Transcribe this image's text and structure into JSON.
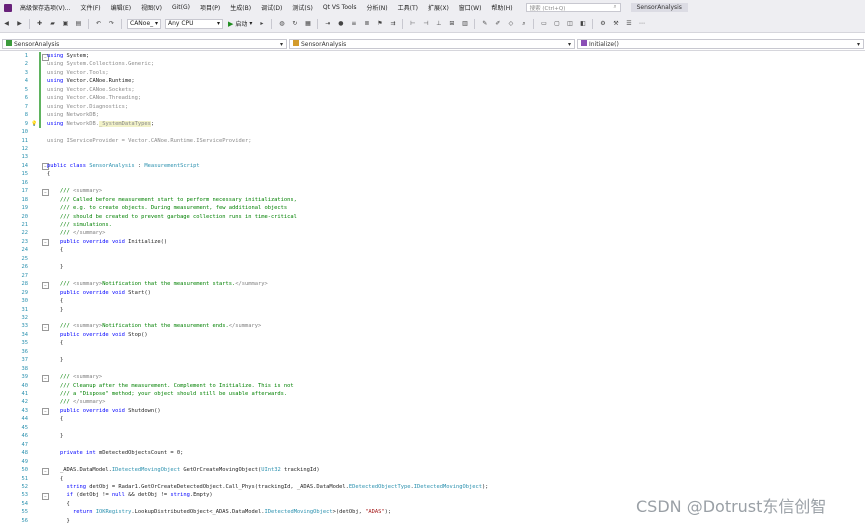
{
  "menu": {
    "title_short": "高级保存选项(V)...",
    "items": [
      "文件(F)",
      "编辑(E)",
      "视图(V)",
      "Git(G)",
      "项目(P)",
      "生成(B)",
      "调试(D)",
      "测试(S)",
      "Qt VS Tools",
      "分析(N)",
      "工具(T)",
      "扩展(X)",
      "窗口(W)",
      "帮助(H)"
    ],
    "search_placeholder": "搜索 (Ctrl+Q)",
    "solution_name": "SensorAnalysis"
  },
  "toolbar": {
    "config": "CANoe_",
    "platform": "Any CPU",
    "start_label": "启动"
  },
  "navbar": {
    "project": "SensorAnalysis",
    "class": "SensorAnalysis",
    "member": "Initialize()"
  },
  "code_lines": [
    {
      "n": "1",
      "t": "using System;"
    },
    {
      "n": "2",
      "t": "using System.Collections.Generic;"
    },
    {
      "n": "3",
      "t": "using Vector.Tools;"
    },
    {
      "n": "4",
      "t": "using Vector.CANoe.Runtime;"
    },
    {
      "n": "5",
      "t": "using Vector.CANoe.Sockets;"
    },
    {
      "n": "6",
      "t": "using Vector.CANoe.Threading;"
    },
    {
      "n": "7",
      "t": "using Vector.Diagnostics;"
    },
    {
      "n": "8",
      "t": "using NetworkDB;"
    },
    {
      "n": "9",
      "t": "using NetworkDB._SystemDataTypes;"
    },
    {
      "n": "10",
      "t": ""
    },
    {
      "n": "11",
      "t": "using IServiceProvider = Vector.CANoe.Runtime.IServiceProvider;"
    },
    {
      "n": "12",
      "t": ""
    },
    {
      "n": "13",
      "t": ""
    },
    {
      "n": "14",
      "t": "public class SensorAnalysis : MeasurementScript"
    },
    {
      "n": "15",
      "t": "{"
    },
    {
      "n": "16",
      "t": ""
    },
    {
      "n": "17",
      "t": "    /// <summary>"
    },
    {
      "n": "18",
      "t": "    /// Called before measurement start to perform necessary initializations,"
    },
    {
      "n": "19",
      "t": "    /// e.g. to create objects. During measurement, few additional objects"
    },
    {
      "n": "20",
      "t": "    /// should be created to prevent garbage collection runs in time-critical"
    },
    {
      "n": "21",
      "t": "    /// simulations."
    },
    {
      "n": "22",
      "t": "    /// </summary>"
    },
    {
      "n": "23",
      "t": "    public override void Initialize()"
    },
    {
      "n": "24",
      "t": "    {"
    },
    {
      "n": "25",
      "t": ""
    },
    {
      "n": "26",
      "t": "    }"
    },
    {
      "n": "27",
      "t": ""
    },
    {
      "n": "28",
      "t": "    /// <summary>Notification that the measurement starts.</summary>"
    },
    {
      "n": "29",
      "t": "    public override void Start()"
    },
    {
      "n": "30",
      "t": "    {"
    },
    {
      "n": "31",
      "t": "    }"
    },
    {
      "n": "32",
      "t": ""
    },
    {
      "n": "33",
      "t": "    /// <summary>Notification that the measurement ends.</summary>"
    },
    {
      "n": "34",
      "t": "    public override void Stop()"
    },
    {
      "n": "35",
      "t": "    {"
    },
    {
      "n": "36",
      "t": ""
    },
    {
      "n": "37",
      "t": "    }"
    },
    {
      "n": "38",
      "t": ""
    },
    {
      "n": "39",
      "t": "    /// <summary>"
    },
    {
      "n": "40",
      "t": "    /// Cleanup after the measurement. Complement to Initialize. This is not"
    },
    {
      "n": "41",
      "t": "    /// a \"Dispose\" method; your object should still be usable afterwards."
    },
    {
      "n": "42",
      "t": "    /// </summary>"
    },
    {
      "n": "43",
      "t": "    public override void Shutdown()"
    },
    {
      "n": "44",
      "t": "    {"
    },
    {
      "n": "45",
      "t": ""
    },
    {
      "n": "46",
      "t": "    }"
    },
    {
      "n": "47",
      "t": ""
    },
    {
      "n": "48",
      "t": "    private int mDetectedObjectsCount = 0;"
    },
    {
      "n": "49",
      "t": ""
    },
    {
      "n": "50",
      "t": "    _ADAS.DataModel.IDetectedMovingObject GetOrCreateMovingObject(UInt32 trackingId)"
    },
    {
      "n": "51",
      "t": "    {"
    },
    {
      "n": "52",
      "t": "      string detObj = Radar1.GetOrCreateDetectedObject.Call_Phys(trackingId, _ADAS.DataModel.EDetectedObjectType.IDetectedMovingObject);"
    },
    {
      "n": "53",
      "t": "      if (detObj != null && detObj != string.Empty)"
    },
    {
      "n": "54",
      "t": "      {"
    },
    {
      "n": "55",
      "t": "        return IOKRegistry.LookupDistributedObject<_ADAS.DataModel.IDetectedMovingObject>(detObj, \"ADAS\");"
    },
    {
      "n": "56",
      "t": "      }"
    }
  ],
  "watermark": "CSDN @Dotrust东信创智"
}
